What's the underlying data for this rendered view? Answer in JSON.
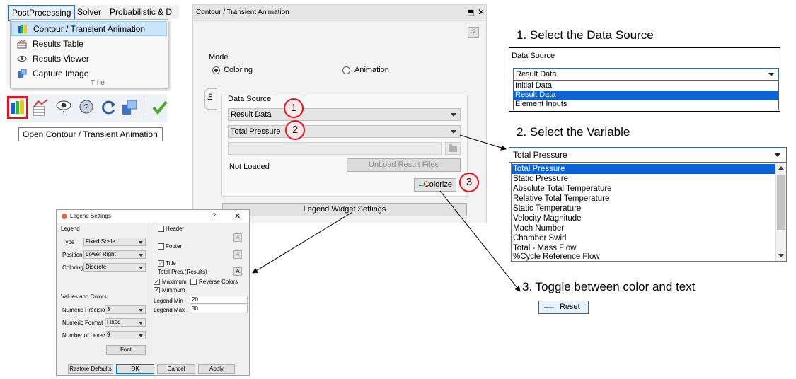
{
  "menu": {
    "menubar": [
      "PostProcessing",
      "Solver",
      "Probabilistic & D"
    ],
    "items": [
      "Contour / Transient Animation",
      "Results Table",
      "Results Viewer",
      "Capture Image"
    ],
    "partial_text": "T f e"
  },
  "tooltip": "Open Contour / Transient Animation",
  "cta": {
    "title": "Contour / Transient Animation",
    "help": "?",
    "controls": [
      "⬒",
      "✕"
    ],
    "mode_label": "Mode",
    "mode_options": [
      "Coloring",
      "Animation"
    ],
    "mode_selected": "Coloring",
    "side_tab": "flo",
    "data_source_label": "Data Source",
    "data_source_value": "Result Data",
    "variable_value": "Total Pressure",
    "status": "Not Loaded",
    "unload_button": "UnLoad Result Files",
    "colorize_button": "Colorize",
    "legend_widget_button": "Legend Widget Settings",
    "callouts": [
      "1",
      "2",
      "3"
    ]
  },
  "legend": {
    "title": "Legend Settings",
    "help": "?",
    "close": "✕",
    "legend_group": "Legend",
    "type_label": "Type",
    "type_value": "Fixed Scale",
    "position_label": "Position",
    "position_value": "Lower Right",
    "coloring_label": "Coloring",
    "coloring_value": "Discrete",
    "values_group": "Values and Colors",
    "precision_label": "Numeric Precision",
    "precision_value": "3",
    "format_label": "Numeric Format",
    "format_value": "Fixed",
    "levels_label": "Number of Levels",
    "levels_value": "9",
    "font_button": "Font",
    "header_label": "Header",
    "footer_label": "Footer",
    "title_label": "Title",
    "title_text": "Total Pres.(Results)",
    "a_button": "A",
    "maximum_label": "Maximum",
    "reverse_label": "Reverse Colors",
    "minimum_label": "Minimum",
    "legend_min_label": "Legend Min",
    "legend_min_value": "20",
    "legend_max_label": "Legend Max",
    "legend_max_value": "30",
    "buttons": [
      "Restore Defaults",
      "OK",
      "Cancel",
      "Apply"
    ]
  },
  "steps": {
    "step1": "1. Select the Data Source",
    "step2": "2. Select the Variable",
    "step3": "3. Toggle between color and text"
  },
  "data_source_box": {
    "label": "Data Source",
    "value": "Result Data",
    "options": [
      "Initial Data",
      "Result Data",
      "Element Inputs"
    ],
    "selected": "Result Data"
  },
  "variable_box": {
    "value": "Total Pressure",
    "options": [
      "Total Pressure",
      "Static Pressure",
      "Absolute Total Temperature",
      "Relative Total Temperature",
      "Static Temperature",
      "Velocity Magnitude",
      "Mach Number",
      "Chamber Swirl",
      "Total - Mass Flow",
      "%Cycle Reference Flow"
    ],
    "selected": "Total Pressure"
  },
  "reset_button": "Reset",
  "colors": {
    "highlight": "#0a64d6",
    "callout": "#e0141e",
    "menu_select": "#cce4f7"
  }
}
